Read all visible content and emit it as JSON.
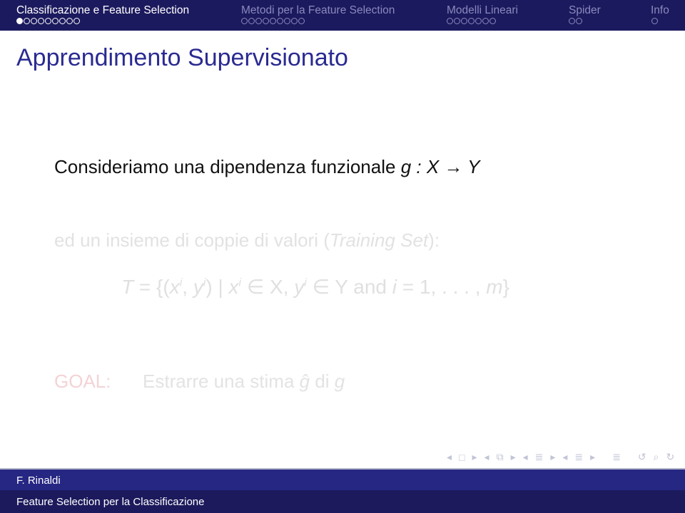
{
  "headline": {
    "sections": [
      {
        "label": "Classificazione e Feature Selection",
        "dots": 9,
        "current": 1,
        "active": true
      },
      {
        "label": "Metodi per la Feature Selection",
        "dots": 9,
        "current": 0,
        "active": false
      },
      {
        "label": "Modelli Lineari",
        "dots": 7,
        "current": 0,
        "active": false
      },
      {
        "label": "Spider",
        "dots": 2,
        "current": 0,
        "active": false
      },
      {
        "label": "Info",
        "dots": 1,
        "current": 0,
        "active": false
      }
    ]
  },
  "frame": {
    "title": "Apprendimento Supervisionato",
    "line1_text": "Consideriamo una dipendenza funzionale",
    "line1_math": "g : X → Y",
    "line2_prefix": "ed un insieme di coppie di valori (",
    "line2_italic": "Training Set",
    "line2_suffix": "):",
    "formula": {
      "lhs": "T",
      "eq": " = {(",
      "x": "x",
      "sup_i": "i",
      "comma": ", ",
      "y": "y",
      "mid": ") | ",
      "in_x": " ∈ X, ",
      "in_y": " ∈ Y ",
      "and": " and ",
      "i": "i",
      "range": " = 1, . . . , ",
      "m": "m",
      "close": "}"
    },
    "goal_label": "GOAL:",
    "goal_text": "Estrarre una stima",
    "goal_ghat": "ĝ",
    "goal_di": " di ",
    "goal_g": "g"
  },
  "navigation": {
    "symbols": [
      "◂",
      "□",
      "▸",
      "◂",
      "⧉",
      "▸",
      "◂",
      "≣",
      "▸",
      "◂",
      "≣",
      "▸",
      "≣",
      "↺",
      "⌕",
      "↻"
    ]
  },
  "footer": {
    "author": "F. Rinaldi",
    "short_title": "Feature Selection per la Classificazione"
  },
  "colors": {
    "headline_bg": "#1c1a5e",
    "title": "#2a2a92",
    "goal_label": "#f3d3d6"
  }
}
